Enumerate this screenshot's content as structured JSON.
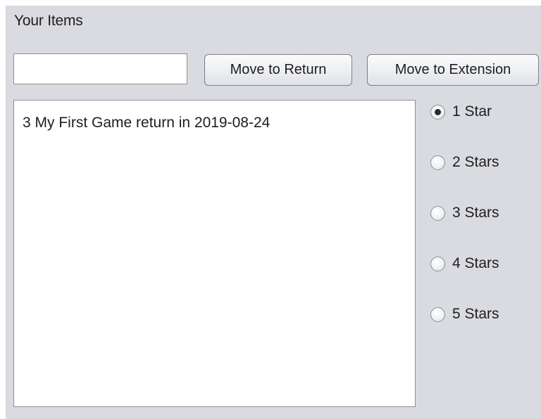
{
  "panel": {
    "title": "Your Items"
  },
  "input": {
    "value": "",
    "placeholder": ""
  },
  "buttons": {
    "move_to_return": "Move to Return",
    "move_to_extension": "Move to Extension"
  },
  "items_list": {
    "items": [
      "3 My First Game return in 2019-08-24"
    ]
  },
  "rating": {
    "selected": "1 Star",
    "options": [
      "1 Star",
      "2 Stars",
      "3 Stars",
      "4 Stars",
      "5 Stars"
    ]
  },
  "colors": {
    "panel_background": "#dadbe0",
    "field_background": "#ffffff",
    "border": "#8c9096",
    "text": "#1e1e1e"
  }
}
